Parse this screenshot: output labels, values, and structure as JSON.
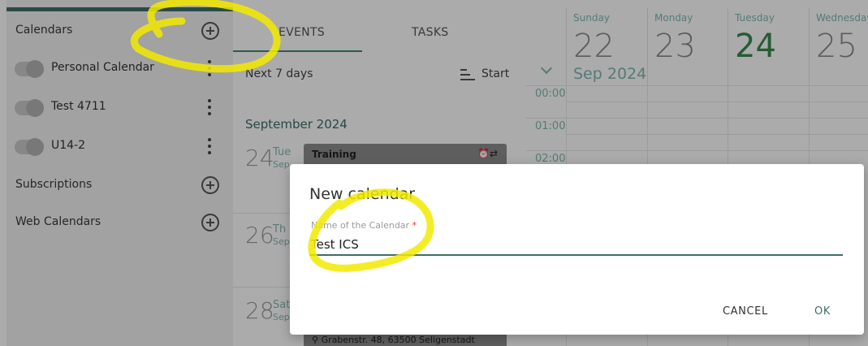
{
  "sidebar": {
    "calendars_title": "Calendars",
    "items": [
      {
        "label": "Personal Calendar"
      },
      {
        "label": "Test 4711"
      },
      {
        "label": "U14-2"
      }
    ],
    "subscriptions_title": "Subscriptions",
    "web_calendars_title": "Web Calendars"
  },
  "middle": {
    "tabs": [
      {
        "label": "EVENTS"
      },
      {
        "label": "TASKS"
      }
    ],
    "range_label": "Next 7 days",
    "sort_label": "Start",
    "month_label": "September 2024",
    "days": [
      {
        "num": "24",
        "name": "Tue",
        "mon": "Sep"
      },
      {
        "num": "26",
        "name": "Th",
        "mon": "Sep"
      },
      {
        "num": "28",
        "name": "Sat",
        "mon": "Sep"
      }
    ],
    "event_title": "Training",
    "event_location": "Grabenstr. 48, 63500 Seligenstadt"
  },
  "calendar": {
    "columns": [
      {
        "weekday": "Sunday",
        "day": "22"
      },
      {
        "weekday": "Monday",
        "day": "23"
      },
      {
        "weekday": "Tuesday",
        "day": "24"
      },
      {
        "weekday": "Wednesday",
        "day": "25"
      }
    ],
    "month_label": "Sep",
    "year_label": "2024",
    "times": [
      "00:00",
      "01:00",
      "02:00"
    ]
  },
  "dialog": {
    "title": "New calendar",
    "field_label": "Name of the Calendar",
    "required_mark": "*",
    "field_value": "Test ICS",
    "cancel_label": "CANCEL",
    "ok_label": "OK"
  },
  "colors": {
    "accent": "#3d6e68",
    "highlight": "#f2ea00",
    "today": "#3a8a4e"
  }
}
